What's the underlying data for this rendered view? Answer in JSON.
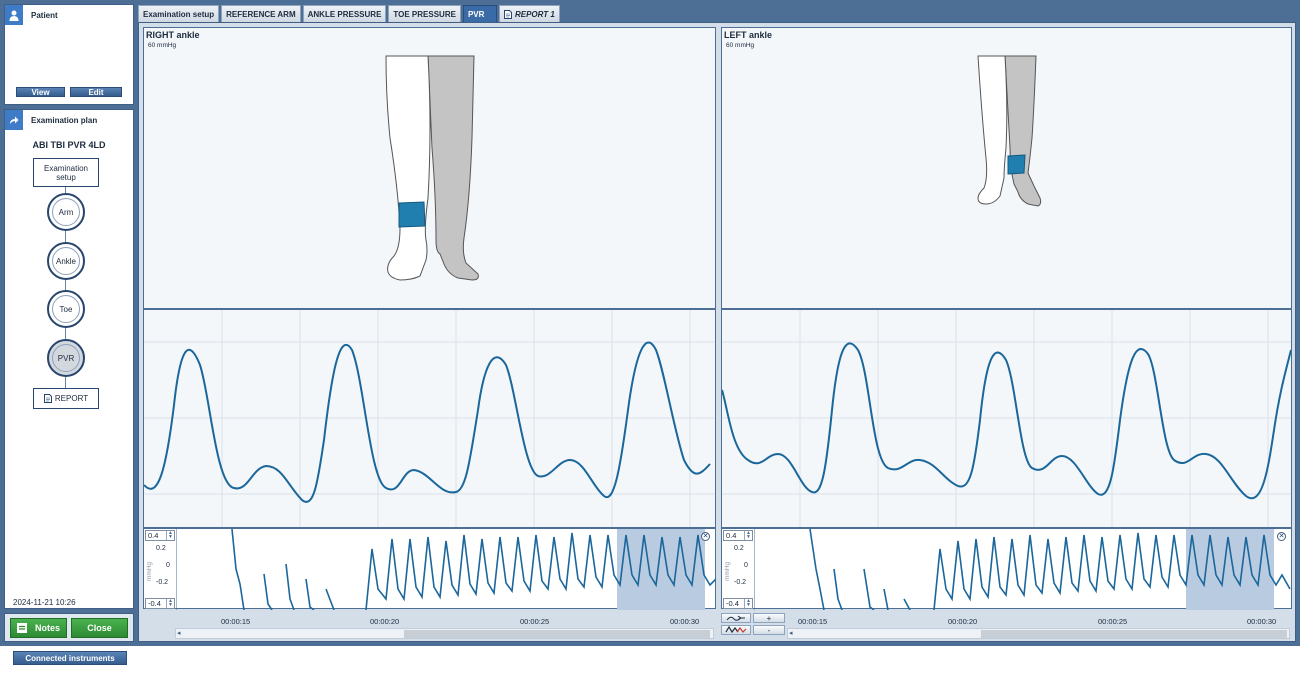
{
  "patient": {
    "title": "Patient",
    "view_label": "View",
    "edit_label": "Edit"
  },
  "plan": {
    "title": "Examination plan",
    "exam_name": "ABI TBI PVR 4LD",
    "steps": {
      "setup": "Examination setup",
      "arm": "Arm",
      "ankle": "Ankle",
      "toe": "Toe",
      "pvr": "PVR",
      "report": "REPORT"
    },
    "date": "2024-11-21 10:26"
  },
  "actions": {
    "notes_label": "Notes",
    "close_label": "Close"
  },
  "connected_label": "Connected instruments",
  "tabs": [
    {
      "label": "Examination setup"
    },
    {
      "label": "REFERENCE ARM"
    },
    {
      "label": "ANKLE PRESSURE"
    },
    {
      "label": "TOE PRESSURE"
    },
    {
      "label": "PVR"
    },
    {
      "label": "REPORT 1"
    }
  ],
  "right": {
    "title": "RIGHT ankle",
    "pressure": "60 mmHg",
    "scale_top": "0.4",
    "scale_bottom": "-0.4",
    "tick_mid": "0",
    "tick_upper": "0.2",
    "tick_lower": "-0.2",
    "unit": "mmHg",
    "times": [
      "00:00:15",
      "00:00:20",
      "00:00:25",
      "00:00:30"
    ]
  },
  "left": {
    "title": "LEFT ankle",
    "pressure": "60 mmHg",
    "scale_top": "0.4",
    "scale_bottom": "-0.4",
    "tick_mid": "0",
    "tick_upper": "0.2",
    "tick_lower": "-0.2",
    "unit": "mmHg",
    "times": [
      "00:00:15",
      "00:00:20",
      "00:00:25",
      "00:00:30"
    ]
  },
  "zoom": {
    "plus": "+",
    "minus": "-"
  },
  "colors": {
    "waveform": "#1b679b",
    "cuff": "#217fb0",
    "accent": "#3e7cc7",
    "selection": "#b9cbe0"
  }
}
